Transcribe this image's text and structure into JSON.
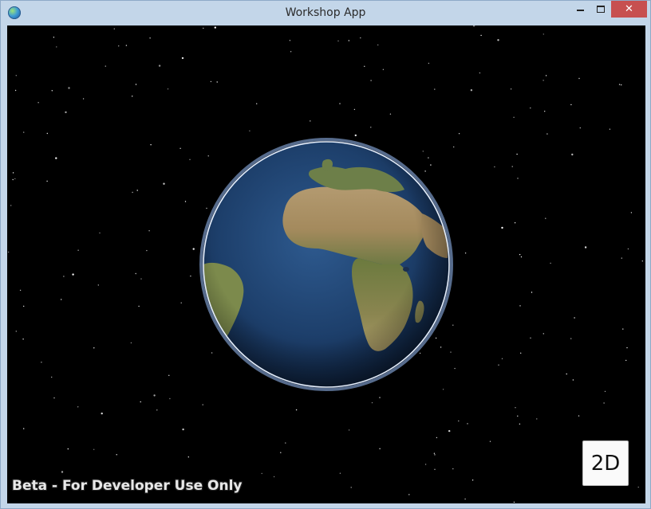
{
  "window": {
    "title": "Workshop App",
    "close_glyph": "✕"
  },
  "scene": {
    "mode_toggle_label": "2D",
    "watermark": "Beta - For Developer Use Only"
  },
  "icons": {
    "app": "globe-icon",
    "minimize": "minimize-icon",
    "maximize": "maximize-icon",
    "close": "close-icon"
  },
  "colors": {
    "space": "#000000",
    "titlebar": "#c3d6e9",
    "close_button": "#c75050",
    "ocean": "#1d3f6b",
    "land_green": "#6e7f45",
    "land_desert": "#b89a6a",
    "atmosphere": "#cfe3ff"
  }
}
